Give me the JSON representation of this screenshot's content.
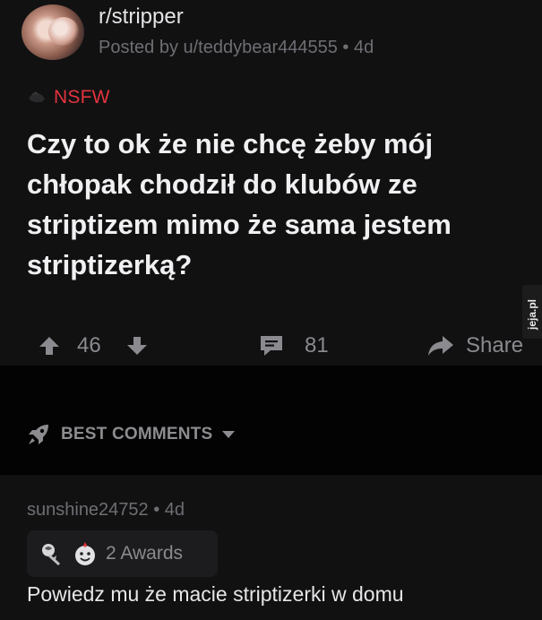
{
  "post": {
    "subreddit": "r/stripper",
    "meta": "Posted by u/teddybear444555 • 4d",
    "nsfw_label": "NSFW",
    "title": "Czy to ok że nie chcę żeby mój chłopak chodził do klubów ze striptizem mimo że sama jestem striptizerką?",
    "score": "46",
    "comments_count": "81",
    "share_label": "Share"
  },
  "watermark": "jeja.pl",
  "comments_section": {
    "sort_label": "BEST COMMENTS"
  },
  "comment": {
    "meta": "sunshine24752 • 4d",
    "awards_label": "2 Awards",
    "body": "Powiedz mu że macie striptizerki w domu"
  },
  "icons": {
    "upvote": "arrow-up-icon",
    "downvote": "arrow-down-icon",
    "comments": "speech-bubble-icon",
    "share": "share-arrow-icon",
    "sort": "rocket-icon",
    "dropdown": "caret-down-icon",
    "nsfw": "nsfw-hand-icon",
    "award1": "rose-award-icon",
    "award2": "wholesome-award-icon"
  },
  "colors": {
    "nsfw": "#e3343d",
    "background": "#111112",
    "muted": "#8a8a8f"
  }
}
